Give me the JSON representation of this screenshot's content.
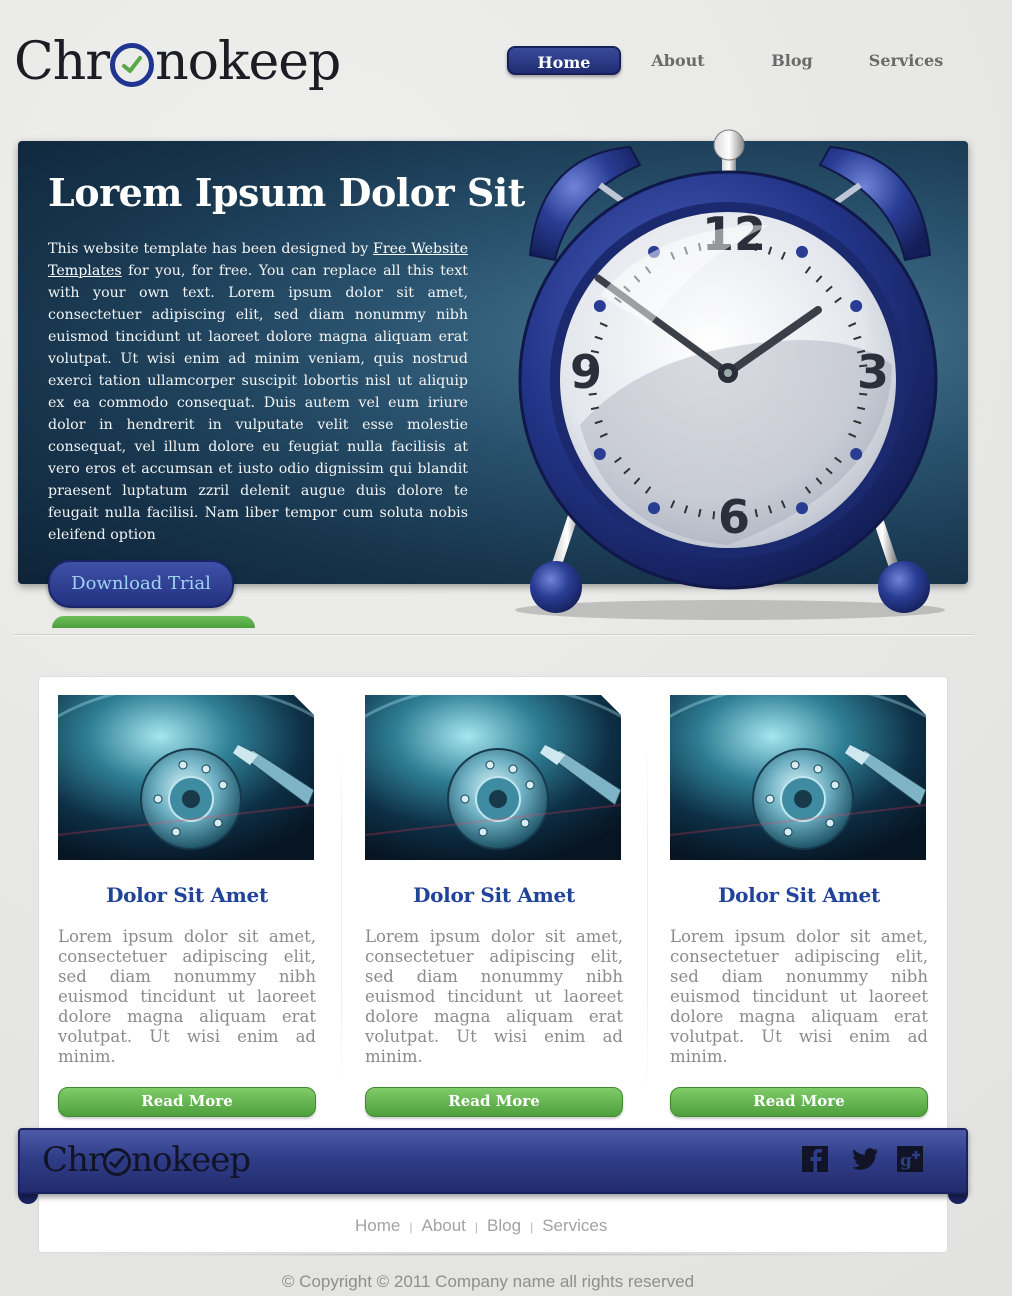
{
  "brand": {
    "name_prefix": "Chr",
    "name_suffix": "nokeep"
  },
  "nav": {
    "items": [
      "Home",
      "About",
      "Blog",
      "Services"
    ],
    "active": "Home"
  },
  "hero": {
    "title": "Lorem Ipsum Dolor Sit",
    "text_before_link": "This website template has been designed by ",
    "link_text": "Free Website Templates",
    "text_after_link": " for you, for free. You can replace all this text with your own text. Lorem ipsum dolor sit amet, consectetuer adipiscing elit, sed diam nonummy nibh euismod tincidunt ut laoreet dolore magna aliquam erat volutpat. Ut wisi enim ad minim veniam, quis nostrud exerci tation ullamcorper suscipit lobortis nisl ut aliquip ex ea commodo consequat. Duis autem vel eum iriure dolor in hendrerit in vulputate velit esse molestie consequat, vel illum dolore eu feugiat nulla facilisis at vero eros et accumsan et iusto odio dignissim qui blandit praesent luptatum zzril delenit augue duis dolore te feugait nulla facilisi. Nam liber tempor cum soluta nobis eleifend option",
    "download_label": "Download Trial",
    "clock_numbers": [
      "12",
      "3",
      "6",
      "9"
    ]
  },
  "features": [
    {
      "title": "Dolor Sit Amet",
      "text": "Lorem ipsum dolor sit amet, consectetuer adipiscing elit, sed diam nonummy nibh euismod tincidunt ut laoreet dolore magna aliquam erat volutpat. Ut wisi enim ad minim.",
      "button": "Read More"
    },
    {
      "title": "Dolor Sit Amet",
      "text": "Lorem ipsum dolor sit amet, consectetuer adipiscing elit, sed diam nonummy nibh euismod tincidunt ut laoreet dolore magna aliquam erat volutpat. Ut wisi enim ad minim.",
      "button": "Read More"
    },
    {
      "title": "Dolor Sit Amet",
      "text": "Lorem ipsum dolor sit amet, consectetuer adipiscing elit, sed diam nonummy nibh euismod tincidunt ut laoreet dolore magna aliquam erat volutpat. Ut wisi enim ad minim.",
      "button": "Read More"
    }
  ],
  "footer": {
    "social_icons": [
      "facebook-icon",
      "twitter-icon",
      "google-plus-icon"
    ],
    "links": [
      "Home",
      "About",
      "Blog",
      "Services"
    ],
    "copyright": "© Copyright © 2011 Company name all rights reserved"
  },
  "colors": {
    "brand_blue": "#1f3590",
    "accent_green": "#5aa947",
    "feature_title": "#21439a",
    "hero_bg": "#17354d"
  }
}
